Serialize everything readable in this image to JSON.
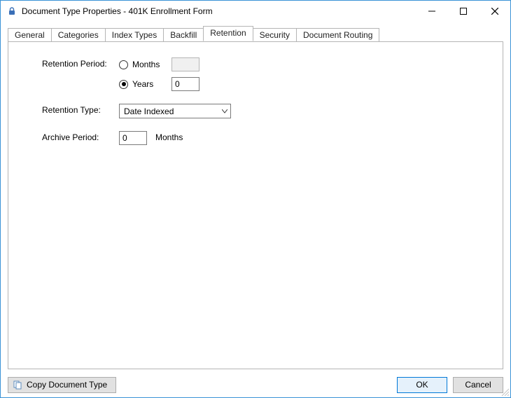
{
  "window": {
    "title": "Document Type Properties  - 401K Enrollment Form"
  },
  "tabs": {
    "general": "General",
    "categories": "Categories",
    "index_types": "Index Types",
    "backfill": "Backfill",
    "retention": "Retention",
    "security": "Security",
    "document_routing": "Document Routing"
  },
  "form": {
    "retention_period_label": "Retention Period:",
    "months_label": "Months",
    "months_value": "",
    "years_label": "Years",
    "years_value": "0",
    "retention_type_label": "Retention Type:",
    "retention_type_value": "Date Indexed",
    "archive_period_label": "Archive Period:",
    "archive_period_value": "0",
    "archive_unit_label": "Months"
  },
  "buttons": {
    "copy": "Copy Document Type",
    "ok": "OK",
    "cancel": "Cancel"
  }
}
